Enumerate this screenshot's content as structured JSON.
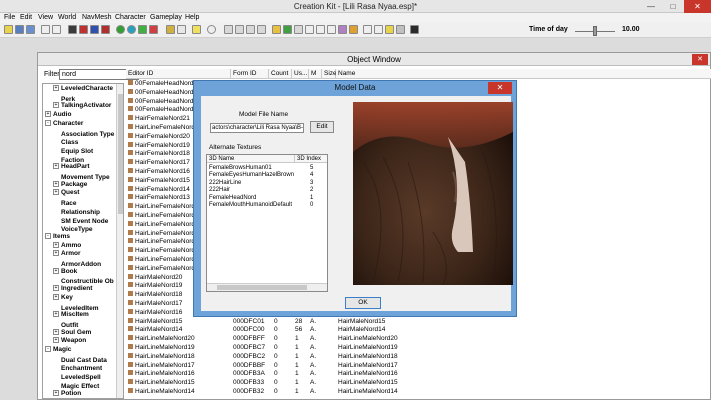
{
  "app": {
    "title": "Creation Kit - [Lili Rasa Nyaa.esp]*"
  },
  "menu": [
    "File",
    "Edit",
    "View",
    "World",
    "NavMesh",
    "Character",
    "Gameplay",
    "Help"
  ],
  "toolbar": {
    "time_of_day_label": "Time of day",
    "time_of_day_value": "10.00"
  },
  "object_window": {
    "title": "Object Window",
    "filter_label": "Filter",
    "filter_value": "nord",
    "tree": [
      {
        "label": "LeveledCharacte",
        "level": 1,
        "expander": "+"
      },
      {
        "label": "Perk",
        "level": 1,
        "expander": ""
      },
      {
        "label": "TalkingActivator",
        "level": 1,
        "expander": "+"
      },
      {
        "label": "Audio",
        "level": 0,
        "expander": "+"
      },
      {
        "label": "Character",
        "level": 0,
        "expander": "-"
      },
      {
        "label": "Association Type",
        "level": 1,
        "expander": ""
      },
      {
        "label": "Class",
        "level": 1,
        "expander": ""
      },
      {
        "label": "Equip Slot",
        "level": 1,
        "expander": ""
      },
      {
        "label": "Faction",
        "level": 1,
        "expander": ""
      },
      {
        "label": "HeadPart",
        "level": 1,
        "expander": "+"
      },
      {
        "label": "Movement Type",
        "level": 1,
        "expander": ""
      },
      {
        "label": "Package",
        "level": 1,
        "expander": "+"
      },
      {
        "label": "Quest",
        "level": 1,
        "expander": "+"
      },
      {
        "label": "Race",
        "level": 1,
        "expander": ""
      },
      {
        "label": "Relationship",
        "level": 1,
        "expander": ""
      },
      {
        "label": "SM Event Node",
        "level": 1,
        "expander": ""
      },
      {
        "label": "VoiceType",
        "level": 1,
        "expander": ""
      },
      {
        "label": "Items",
        "level": 0,
        "expander": "-"
      },
      {
        "label": "Ammo",
        "level": 1,
        "expander": "+"
      },
      {
        "label": "Armor",
        "level": 1,
        "expander": "+"
      },
      {
        "label": "ArmorAddon",
        "level": 1,
        "expander": ""
      },
      {
        "label": "Book",
        "level": 1,
        "expander": "+"
      },
      {
        "label": "Constructible Ob",
        "level": 1,
        "expander": ""
      },
      {
        "label": "Ingredient",
        "level": 1,
        "expander": "+"
      },
      {
        "label": "Key",
        "level": 1,
        "expander": "+"
      },
      {
        "label": "LeveledItem",
        "level": 1,
        "expander": ""
      },
      {
        "label": "MiscItem",
        "level": 1,
        "expander": "+"
      },
      {
        "label": "Outfit",
        "level": 1,
        "expander": ""
      },
      {
        "label": "Soul Gem",
        "level": 1,
        "expander": "+"
      },
      {
        "label": "Weapon",
        "level": 1,
        "expander": "+"
      },
      {
        "label": "Magic",
        "level": 0,
        "expander": "-"
      },
      {
        "label": "Dual Cast Data",
        "level": 1,
        "expander": ""
      },
      {
        "label": "Enchantment",
        "level": 1,
        "expander": ""
      },
      {
        "label": "LeveledSpell",
        "level": 1,
        "expander": ""
      },
      {
        "label": "Magic Effect",
        "level": 1,
        "expander": ""
      },
      {
        "label": "Potion",
        "level": 1,
        "expander": "+"
      }
    ],
    "columns": [
      "Editor ID",
      "Form ID",
      "Count",
      "Us...",
      "M",
      "Size",
      "Name"
    ],
    "rows": [
      {
        "editor_id": "00FemaleHeadNordd",
        "form_id": "",
        "count": "",
        "users": "",
        "m": "",
        "name": ""
      },
      {
        "editor_id": "00FemaleHeadNordLili",
        "form_id": "",
        "count": "",
        "users": "",
        "m": "",
        "name": ""
      },
      {
        "editor_id": "00FemaleHeadNordLili",
        "form_id": "",
        "count": "",
        "users": "",
        "m": "",
        "name": ""
      },
      {
        "editor_id": "00FemaleHeadNordLili",
        "form_id": "",
        "count": "",
        "users": "",
        "m": "",
        "name": ""
      },
      {
        "editor_id": "HairFemaleNord21",
        "form_id": "",
        "count": "",
        "users": "",
        "m": "",
        "name": ""
      },
      {
        "editor_id": "HairLineFemaleNord21",
        "form_id": "",
        "count": "",
        "users": "",
        "m": "",
        "name": ""
      },
      {
        "editor_id": "HairFemaleNord20",
        "form_id": "",
        "count": "",
        "users": "",
        "m": "",
        "name": ""
      },
      {
        "editor_id": "HairFemaleNord19",
        "form_id": "",
        "count": "",
        "users": "",
        "m": "",
        "name": ""
      },
      {
        "editor_id": "HairFemaleNord18",
        "form_id": "",
        "count": "",
        "users": "",
        "m": "",
        "name": ""
      },
      {
        "editor_id": "HairFemaleNord17",
        "form_id": "",
        "count": "",
        "users": "",
        "m": "",
        "name": ""
      },
      {
        "editor_id": "HairFemaleNord16",
        "form_id": "",
        "count": "",
        "users": "",
        "m": "",
        "name": ""
      },
      {
        "editor_id": "HairFemaleNord15",
        "form_id": "",
        "count": "",
        "users": "",
        "m": "",
        "name": ""
      },
      {
        "editor_id": "HairFemaleNord14",
        "form_id": "",
        "count": "",
        "users": "",
        "m": "",
        "name": ""
      },
      {
        "editor_id": "HairFemaleNord13",
        "form_id": "",
        "count": "",
        "users": "",
        "m": "",
        "name": ""
      },
      {
        "editor_id": "HairLineFemaleNord20",
        "form_id": "",
        "count": "",
        "users": "",
        "m": "",
        "name": ""
      },
      {
        "editor_id": "HairLineFemaleNord19",
        "form_id": "",
        "count": "",
        "users": "",
        "m": "",
        "name": ""
      },
      {
        "editor_id": "HairLineFemaleNord18",
        "form_id": "",
        "count": "",
        "users": "",
        "m": "",
        "name": ""
      },
      {
        "editor_id": "HairLineFemaleNord17",
        "form_id": "",
        "count": "",
        "users": "",
        "m": "",
        "name": ""
      },
      {
        "editor_id": "HairLineFemaleNord16",
        "form_id": "",
        "count": "",
        "users": "",
        "m": "",
        "name": ""
      },
      {
        "editor_id": "HairLineFemaleNord15",
        "form_id": "",
        "count": "",
        "users": "",
        "m": "",
        "name": ""
      },
      {
        "editor_id": "HairLineFemaleNord14",
        "form_id": "",
        "count": "",
        "users": "",
        "m": "",
        "name": ""
      },
      {
        "editor_id": "HairLineFemaleNord13",
        "form_id": "",
        "count": "",
        "users": "",
        "m": "",
        "name": ""
      },
      {
        "editor_id": "HairMaleNord20",
        "form_id": "",
        "count": "",
        "users": "",
        "m": "",
        "name": ""
      },
      {
        "editor_id": "HairMaleNord19",
        "form_id": "",
        "count": "",
        "users": "",
        "m": "",
        "name": ""
      },
      {
        "editor_id": "HairMaleNord18",
        "form_id": "",
        "count": "",
        "users": "",
        "m": "",
        "name": ""
      },
      {
        "editor_id": "HairMaleNord17",
        "form_id": "",
        "count": "",
        "users": "",
        "m": "",
        "name": ""
      },
      {
        "editor_id": "HairMaleNord16",
        "form_id": "",
        "count": "",
        "users": "",
        "m": "",
        "name": ""
      },
      {
        "editor_id": "HairMaleNord15",
        "form_id": "000DFC01",
        "count": "0",
        "users": "28",
        "m": "A.",
        "name": "HairMaleNord15"
      },
      {
        "editor_id": "HairMaleNord14",
        "form_id": "000DFC00",
        "count": "0",
        "users": "56",
        "m": "A.",
        "name": "HairMaleNord14"
      },
      {
        "editor_id": "HairLineMaleNord20",
        "form_id": "000DFBFF",
        "count": "0",
        "users": "1",
        "m": "A.",
        "name": "HairLineMaleNord20"
      },
      {
        "editor_id": "HairLineMaleNord19",
        "form_id": "000DFBC7",
        "count": "0",
        "users": "1",
        "m": "A.",
        "name": "HairLineMaleNord19"
      },
      {
        "editor_id": "HairLineMaleNord18",
        "form_id": "000DFBC2",
        "count": "0",
        "users": "1",
        "m": "A.",
        "name": "HairLineMaleNord18"
      },
      {
        "editor_id": "HairLineMaleNord17",
        "form_id": "000DFBBF",
        "count": "0",
        "users": "1",
        "m": "A.",
        "name": "HairLineMaleNord17"
      },
      {
        "editor_id": "HairLineMaleNord16",
        "form_id": "000DFB3A",
        "count": "0",
        "users": "1",
        "m": "A.",
        "name": "HairLineMaleNord16"
      },
      {
        "editor_id": "HairLineMaleNord15",
        "form_id": "000DFB33",
        "count": "0",
        "users": "1",
        "m": "A.",
        "name": "HairLineMaleNord15"
      },
      {
        "editor_id": "HairLineMaleNord14",
        "form_id": "000DFB32",
        "count": "0",
        "users": "1",
        "m": "A.",
        "name": "HairLineMaleNord14"
      }
    ]
  },
  "model_dialog": {
    "title": "Model Data",
    "model_file_name_label": "Model File Name",
    "model_file_value": "actors\\character\\Lili Rasa Nyaa\\B-",
    "edit_label": "Edit",
    "alt_textures_label": "Alternate Textures",
    "alt_columns": [
      "3D Name",
      "3D Index"
    ],
    "alt_rows": [
      {
        "name": "FemaleBrowsHuman01",
        "index": "5"
      },
      {
        "name": "FemaleEyesHumanHazelBrown",
        "index": "4"
      },
      {
        "name": "222HairLine",
        "index": "3"
      },
      {
        "name": "222Hair",
        "index": "2"
      },
      {
        "name": "FemaleHeadNord",
        "index": "1"
      },
      {
        "name": "FemaleMouthHumanoidDefault",
        "index": "0"
      }
    ],
    "ok_label": "OK"
  },
  "colors": {
    "dialog_frame": "#6da3d8",
    "close_red": "#c7352b",
    "preview_bg": "#2a1810"
  }
}
